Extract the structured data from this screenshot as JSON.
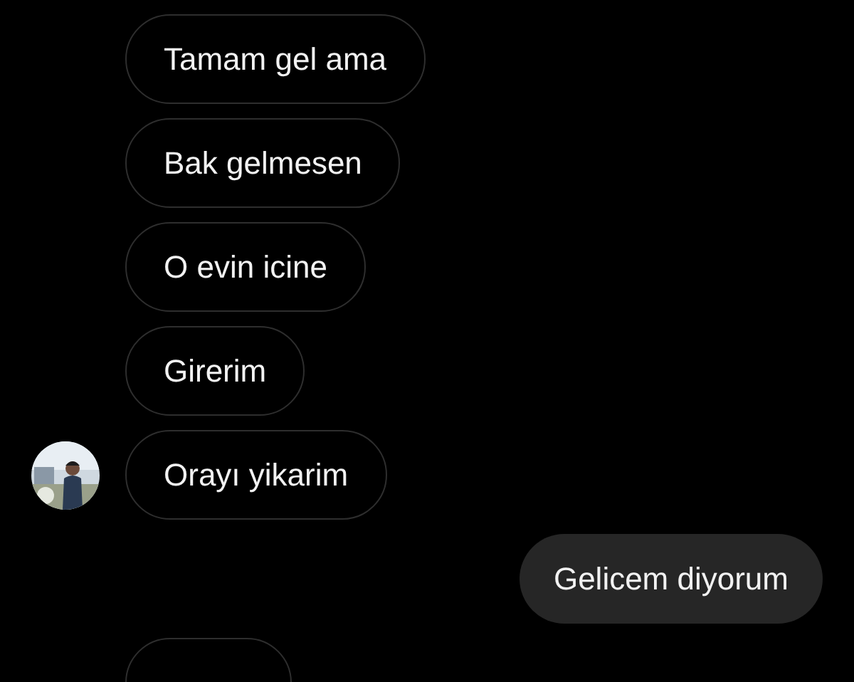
{
  "messages": [
    {
      "kind": "received",
      "text": "Tamam gel ama",
      "avatar": false
    },
    {
      "kind": "received",
      "text": "Bak gelmesen",
      "avatar": false
    },
    {
      "kind": "received",
      "text": "O evin icine",
      "avatar": false
    },
    {
      "kind": "received",
      "text": "Girerim",
      "avatar": false
    },
    {
      "kind": "received",
      "text": "Orayı yikarim",
      "avatar": true
    },
    {
      "kind": "sent",
      "text": "Gelicem diyorum"
    },
    {
      "kind": "received_cut"
    }
  ]
}
